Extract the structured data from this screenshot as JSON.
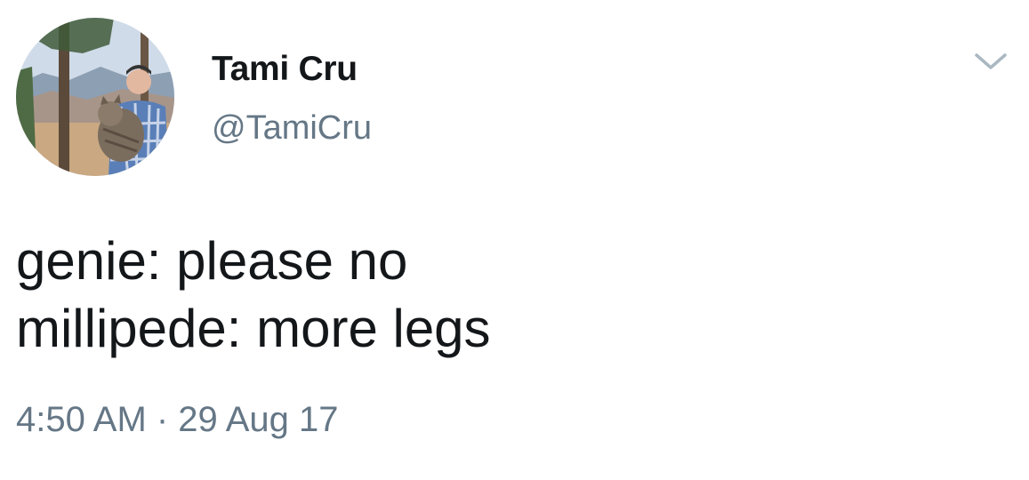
{
  "tweet": {
    "display_name": "Tami Cru",
    "handle": "@TamiCru",
    "text_lines": [
      "genie: please no",
      "millipede: more legs"
    ],
    "timestamp": "4:50 AM · 29 Aug 17",
    "menu_icon": "chevron-down-icon",
    "avatar_description_icon": "profile-photo"
  },
  "colors": {
    "text_primary": "#14171a",
    "text_secondary": "#657786",
    "chevron": "#aab8c2",
    "background": "#ffffff"
  }
}
